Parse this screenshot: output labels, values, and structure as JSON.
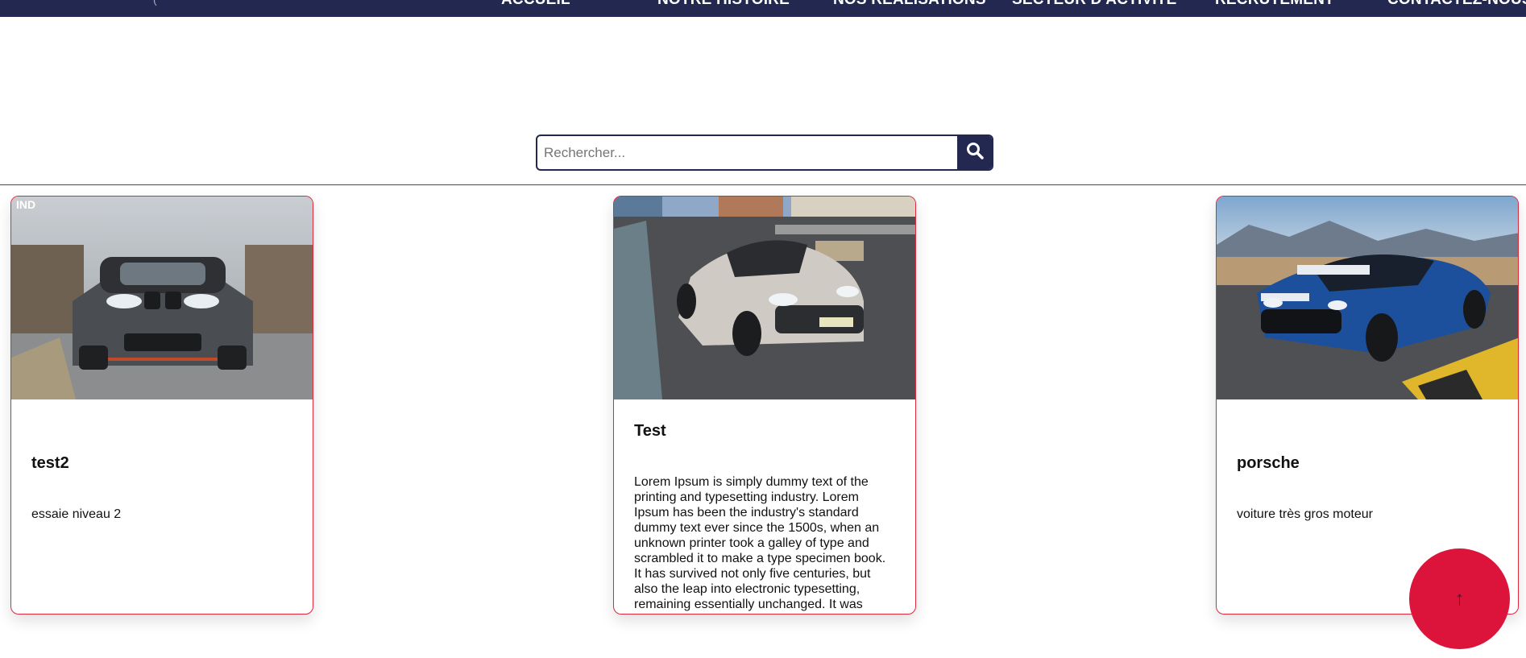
{
  "nav": {
    "logo_glyph": "(",
    "items": [
      {
        "label": "ACCUEIL"
      },
      {
        "label": "NOTRE HISTOIRE"
      },
      {
        "label": "NOS RÉALISATIONS"
      },
      {
        "label": "SECTEUR D'ACTIVITÉ"
      },
      {
        "label": "RECRUTEMENT"
      },
      {
        "label": "CONTACTEZ-NOUS"
      }
    ]
  },
  "search": {
    "placeholder": "Rechercher...",
    "value": "",
    "icon": "search-icon"
  },
  "cards": [
    {
      "title": "test2",
      "description": "essaie niveau 2",
      "image": "grey-bmw-m2-car",
      "watermark": "IND"
    },
    {
      "title": "Test",
      "description": "Lorem Ipsum is simply dummy text of the printing and typesetting industry. Lorem Ipsum has been the industry's standard dummy text ever since the 1500s, when an unknown printer took a galley of type and scrambled it to make a type specimen book. It has survived not only five centuries, but also the leap into electronic typesetting, remaining essentially unchanged. It was",
      "image": "white-mercedes-c63-car"
    },
    {
      "title": "porsche",
      "description": "voiture très gros moteur",
      "image": "blue-mustang-shelby-car"
    }
  ],
  "scroll_top": {
    "glyph": "↑"
  },
  "colors": {
    "navbar": "#232850",
    "accent_red": "#dc143c",
    "card_border": "#e0273c",
    "divider": "#2d3adb"
  }
}
